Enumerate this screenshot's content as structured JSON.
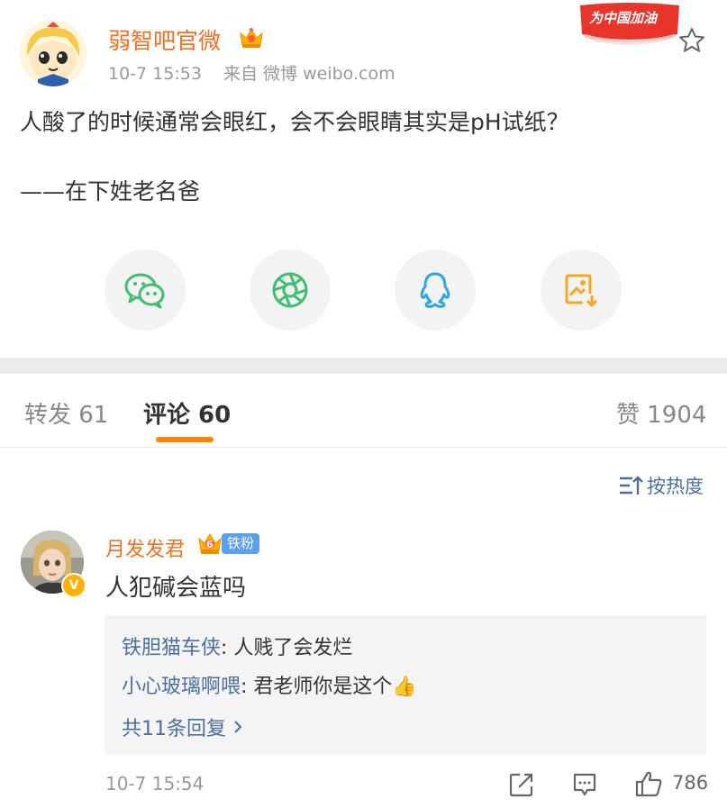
{
  "post": {
    "author": "弱智吧官微",
    "time": "10-7 15:53",
    "source": "来自 微博 weibo.com",
    "banner_text": "为中国加油",
    "text": "人酸了的时候通常会眼红，会不会眼睛其实是pH试纸？",
    "signature": "——在下姓老名爸"
  },
  "share": [
    {
      "name": "wechat-icon",
      "color": "#3dbf6e"
    },
    {
      "name": "moments-icon",
      "color": "#3dbf6e"
    },
    {
      "name": "qq-icon",
      "color": "#2aa7e8"
    },
    {
      "name": "save-image-icon",
      "color": "#f5a623"
    }
  ],
  "tabs": {
    "repost": "转发 61",
    "comments": "评论 60",
    "likes": "赞 1904"
  },
  "sort_label": "按热度",
  "comment": {
    "author": "月发发君",
    "level": "6",
    "fan_badge": "铁粉",
    "text": "人犯碱会蓝吗",
    "replies": [
      {
        "name": "铁胆猫车侠",
        "sep": ": ",
        "text": "人贱了会发烂"
      },
      {
        "name": "小心玻璃啊喂",
        "sep": ": ",
        "text": "君老师你是这个👍"
      }
    ],
    "more_replies": "共11条回复",
    "time": "10-7 15:54",
    "like_count": "786"
  },
  "colors": {
    "accent": "#ff8200",
    "name_orange": "#f37022",
    "link_blue": "#4a6fa5"
  }
}
